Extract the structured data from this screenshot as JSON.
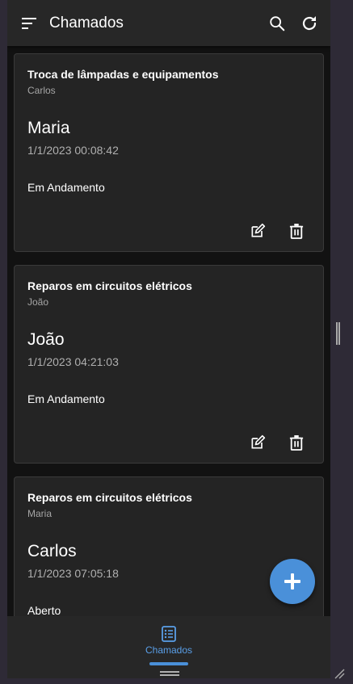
{
  "app_bar": {
    "title": "Chamados",
    "icons": [
      "menu-icon",
      "search-icon",
      "refresh-icon"
    ]
  },
  "cards": [
    {
      "title": "Troca de lâmpadas e equipamentos",
      "subtitle": "Carlos",
      "name": "Maria",
      "date": "1/1/2023 00:08:42",
      "status": "Em Andamento"
    },
    {
      "title": "Reparos em circuitos elétricos",
      "subtitle": "João",
      "name": "João",
      "date": "1/1/2023 04:21:03",
      "status": "Em Andamento"
    },
    {
      "title": "Reparos em circuitos elétricos",
      "subtitle": "Maria",
      "name": "Carlos",
      "date": "1/1/2023 07:05:18",
      "status": "Aberto"
    }
  ],
  "card_actions": [
    "edit-icon",
    "delete-icon"
  ],
  "fab": {
    "icon": "plus-icon"
  },
  "bottom_nav": {
    "items": [
      {
        "label": "Chamados",
        "icon": "list-icon",
        "active": true
      }
    ]
  },
  "colors": {
    "accent": "#4a90d9",
    "surface": "#242424",
    "background": "#121212",
    "app_bar": "#272727"
  }
}
